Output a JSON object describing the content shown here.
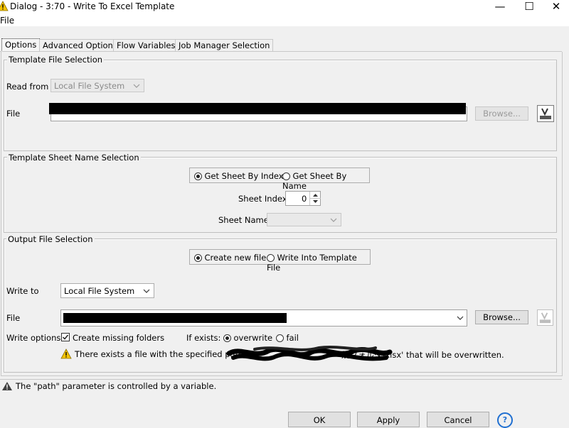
{
  "window": {
    "title": "Dialog - 3:70 - Write To Excel Template",
    "menu_file": "File",
    "minimize": "—",
    "maximize": "☐",
    "close": "✕"
  },
  "tabs": [
    {
      "label": "Options",
      "active": true
    },
    {
      "label": "Advanced Options"
    },
    {
      "label": "Flow Variables"
    },
    {
      "label": "Job Manager Selection"
    }
  ],
  "template_file": {
    "legend": "Template File Selection",
    "read_from_label": "Read from",
    "read_from_value": "Local File System",
    "file_label": "File",
    "browse_label": "Browse..."
  },
  "template_sheet": {
    "legend": "Template Sheet Name Selection",
    "option_index": "Get Sheet By Index",
    "option_name": "Get Sheet By Name",
    "sheet_index_label": "Sheet Index",
    "sheet_index_value": "0",
    "sheet_name_label": "Sheet Name"
  },
  "output_file": {
    "legend": "Output File Selection",
    "option_create": "Create new file",
    "option_write_into": "Write Into Template File",
    "write_to_label": "Write to",
    "write_to_value": "Local File System",
    "file_label": "File",
    "browse_label": "Browse...",
    "write_options_label": "Write options",
    "create_folders_label": "Create missing folders",
    "if_exists_label": "If exists:",
    "overwrite_label": "overwrite",
    "fail_label": "fail",
    "warning_prefix": "There exists a file with the specified path '",
    "warning_suffix": "規フォルダ\\xlsx' that will be overwritten."
  },
  "status": {
    "message": "The \"path\" parameter is controlled by a variable."
  },
  "buttons": {
    "ok": "OK",
    "apply": "Apply",
    "cancel": "Cancel",
    "help": "?"
  },
  "colors": {
    "warning_yellow": "#f5c400",
    "help_blue": "#1f6fd1"
  }
}
